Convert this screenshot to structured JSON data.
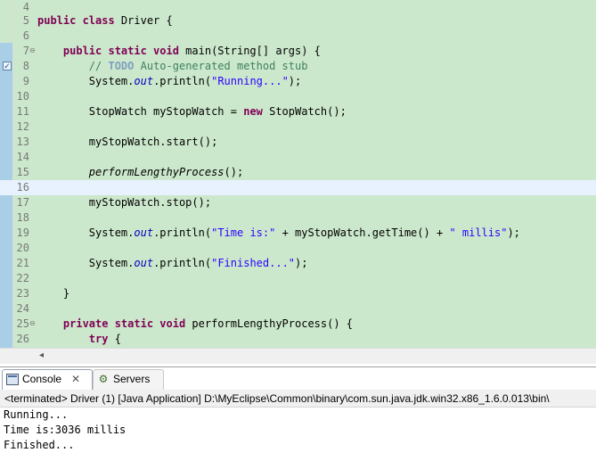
{
  "editor": {
    "lines": [
      {
        "n": "4"
      },
      {
        "n": "5",
        "t1": "public class",
        "t2": " Driver {"
      },
      {
        "n": "6"
      },
      {
        "n": "7",
        "t0": "    ",
        "t1": "public static void",
        "t2": " main(String[] args) {"
      },
      {
        "n": "8",
        "t0": "        ",
        "t1": "// ",
        "t2": "TODO",
        "t3": " Auto-generated method stub"
      },
      {
        "n": "9",
        "t0": "        System.",
        "t1": "out",
        "t2": ".println(",
        "t3": "\"Running...\"",
        "t4": ");"
      },
      {
        "n": "10"
      },
      {
        "n": "11",
        "t0": "        StopWatch myStopWatch = ",
        "t1": "new",
        "t2": " StopWatch();"
      },
      {
        "n": "12"
      },
      {
        "n": "13",
        "t0": "        myStopWatch.start();"
      },
      {
        "n": "14"
      },
      {
        "n": "15",
        "t0": "        ",
        "t1": "performLengthyProcess",
        "t2": "();"
      },
      {
        "n": "16"
      },
      {
        "n": "17",
        "t0": "        myStopWatch.stop();"
      },
      {
        "n": "18"
      },
      {
        "n": "19",
        "t0": "        System.",
        "t1": "out",
        "t2": ".println(",
        "t3": "\"Time is:\"",
        "t4": " + myStopWatch.getTime() + ",
        "t5": "\" millis\"",
        "t6": ");"
      },
      {
        "n": "20"
      },
      {
        "n": "21",
        "t0": "        System.",
        "t1": "out",
        "t2": ".println(",
        "t3": "\"Finished...\"",
        "t4": ");"
      },
      {
        "n": "22"
      },
      {
        "n": "23",
        "t0": "    }"
      },
      {
        "n": "24"
      },
      {
        "n": "25",
        "t0": "    ",
        "t1": "private static void",
        "t2": " performLengthyProcess() {"
      },
      {
        "n": "26",
        "t0": "        ",
        "t1": "try",
        "t2": " {"
      }
    ],
    "fold_glyph": "⊖",
    "task_glyph": "✓"
  },
  "scrollbar": {
    "left_arrow": "◂"
  },
  "tabs": {
    "console": {
      "label": "Console",
      "icon": "console-icon",
      "close": "✕"
    },
    "servers": {
      "label": "Servers",
      "icon": "servers-icon",
      "glyph": "⚙"
    }
  },
  "console": {
    "title": "<terminated> Driver (1) [Java Application] D:\\MyEclipse\\Common\\binary\\com.sun.java.jdk.win32.x86_1.6.0.013\\bin\\",
    "output": [
      "Running...",
      "Time is:3036 millis",
      "Finished..."
    ]
  },
  "colors": {
    "editor_bg": "#cce8cc",
    "current_line": "#e8f2fe",
    "keyword": "#7f0055",
    "string": "#2a00ff",
    "comment": "#3f7f5f",
    "field": "#0000c0"
  }
}
